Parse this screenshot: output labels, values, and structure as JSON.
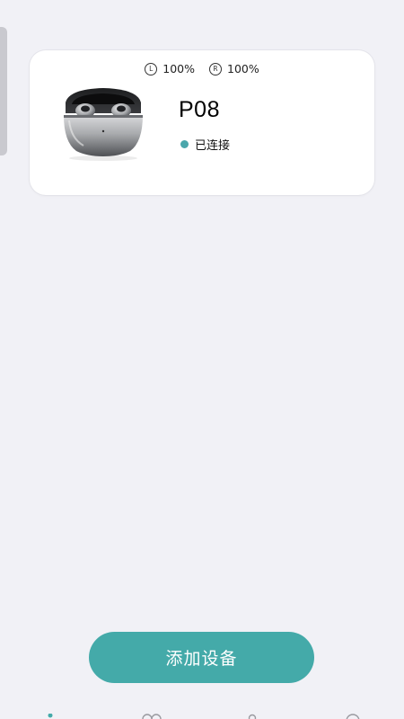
{
  "device": {
    "left_battery_badge": "L",
    "left_battery": "100%",
    "right_battery_badge": "R",
    "right_battery": "100%",
    "name": "P08",
    "status": "已连接",
    "status_color": "#4aa6ab",
    "image_icon": "earbuds-case-image"
  },
  "add_device_button": {
    "label": "添加设备",
    "color": "#44aaa9"
  },
  "bottom_nav": {
    "icons": [
      "home-icon",
      "devices-icon",
      "profile-icon",
      "settings-icon"
    ],
    "active_color": "#44aaa9"
  }
}
